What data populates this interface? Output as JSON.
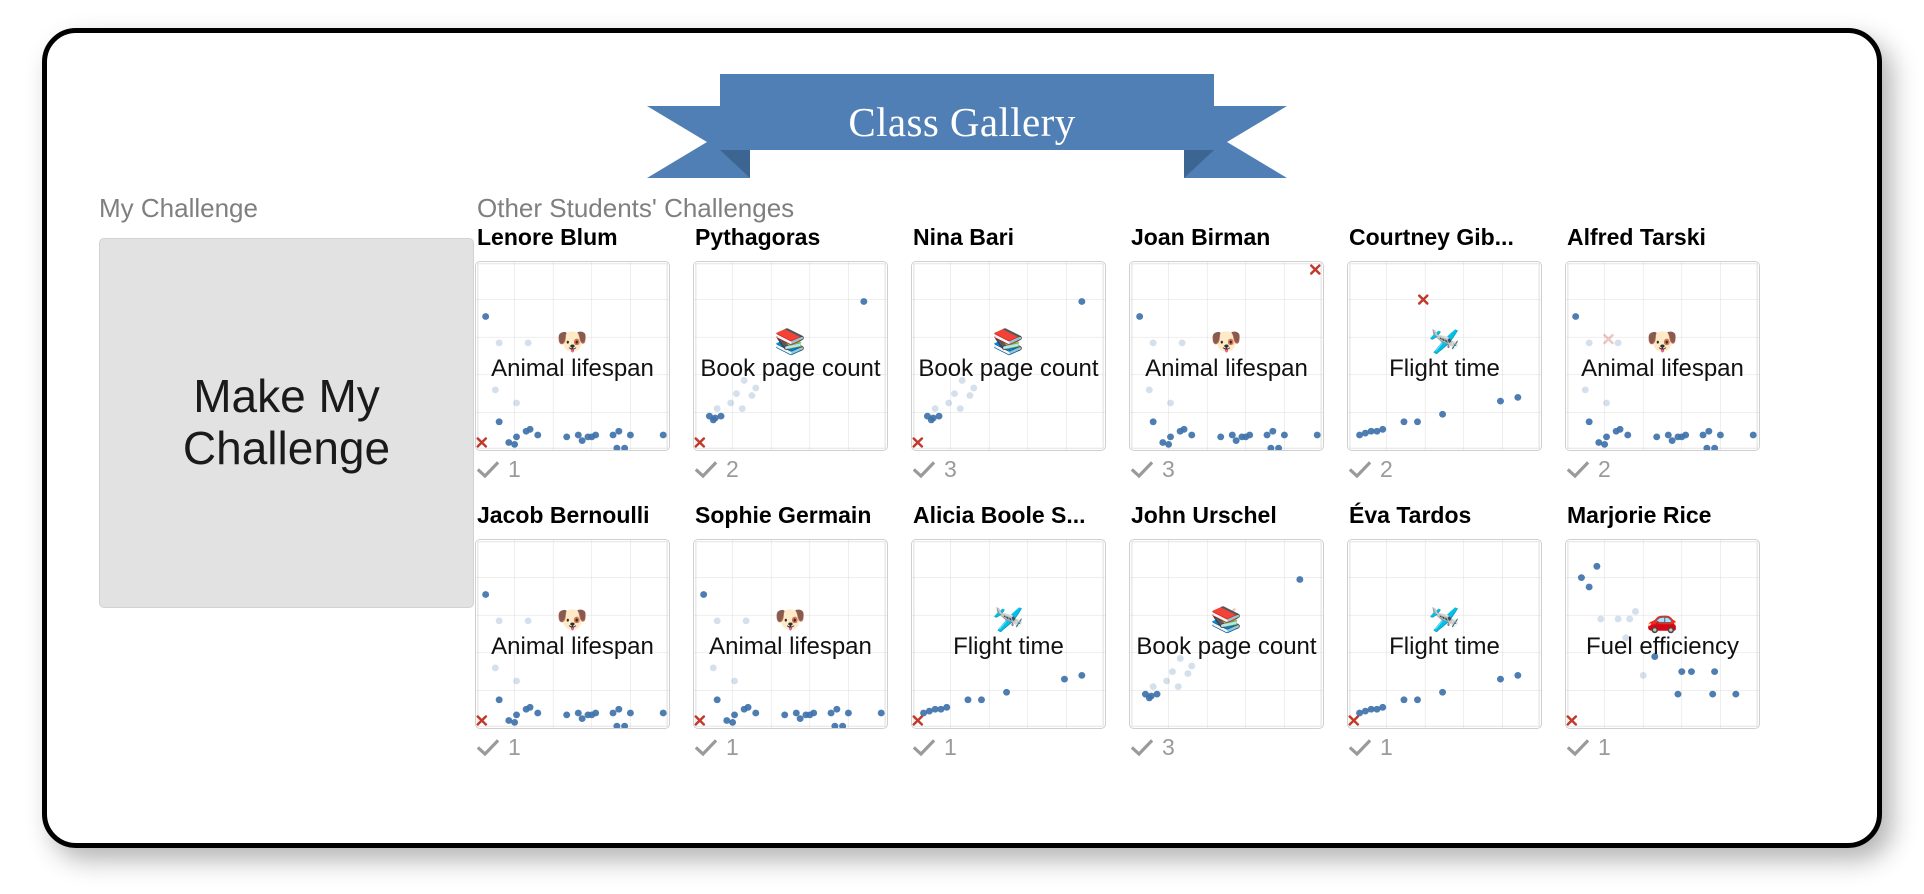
{
  "banner": {
    "title": "Class Gallery",
    "fill_color": "#4f7fb5",
    "fold_color": "#3d6592"
  },
  "my_challenge": {
    "label": "My Challenge",
    "button_label": "Make My Challenge"
  },
  "gallery": {
    "label": "Other Students' Challenges",
    "check_icon": "check-icon",
    "rows": [
      [
        {
          "name": "Lenore Blum",
          "emoji": "🐶",
          "emoji_name": "dog-face-emoji",
          "caption": "Animal lifespan",
          "votes": "1",
          "marker": {
            "x": 3,
            "y": 96,
            "opacity": 1
          },
          "points": [
            [
              5,
              29
            ],
            [
              12,
              43
            ],
            [
              27,
              43
            ],
            [
              10,
              68
            ],
            [
              21,
              75
            ],
            [
              12,
              85
            ],
            [
              21,
              93
            ],
            [
              26,
              90
            ],
            [
              28,
              89
            ],
            [
              32,
              92
            ],
            [
              17,
              96
            ],
            [
              20,
              97
            ],
            [
              47,
              93
            ],
            [
              53,
              92
            ],
            [
              55,
              95
            ],
            [
              58,
              93
            ],
            [
              60,
              93
            ],
            [
              62,
              92
            ],
            [
              71,
              92
            ],
            [
              74,
              90
            ],
            [
              80,
              92
            ],
            [
              73,
              101
            ],
            [
              77,
              103
            ],
            [
              97,
              92
            ]
          ]
        },
        {
          "name": "Pythagoras",
          "emoji": "📚",
          "emoji_name": "books-emoji",
          "caption": "Book page count",
          "votes": "2",
          "marker": {
            "x": 3,
            "y": 96,
            "opacity": 1
          },
          "points": [
            [
              88,
              21
            ],
            [
              26,
              63
            ],
            [
              32,
              67
            ],
            [
              22,
              70
            ],
            [
              30,
              71
            ],
            [
              19,
              75
            ],
            [
              12,
              78
            ],
            [
              25,
              78
            ],
            [
              8,
              82
            ],
            [
              11,
              83
            ],
            [
              14,
              82
            ],
            [
              10,
              84
            ]
          ]
        },
        {
          "name": "Nina Bari",
          "emoji": "📚",
          "emoji_name": "books-emoji",
          "caption": "Book page count",
          "votes": "3",
          "marker": {
            "x": 3,
            "y": 96,
            "opacity": 1
          },
          "points": [
            [
              88,
              21
            ],
            [
              26,
              63
            ],
            [
              32,
              67
            ],
            [
              22,
              70
            ],
            [
              30,
              71
            ],
            [
              19,
              75
            ],
            [
              12,
              78
            ],
            [
              25,
              78
            ],
            [
              8,
              82
            ],
            [
              11,
              83
            ],
            [
              14,
              82
            ],
            [
              10,
              84
            ]
          ]
        },
        {
          "name": "Joan Birman",
          "emoji": "🐶",
          "emoji_name": "dog-face-emoji",
          "caption": "Animal lifespan",
          "votes": "3",
          "marker": {
            "x": 96,
            "y": 4,
            "opacity": 1
          },
          "points": [
            [
              5,
              29
            ],
            [
              12,
              43
            ],
            [
              27,
              43
            ],
            [
              10,
              68
            ],
            [
              21,
              75
            ],
            [
              12,
              85
            ],
            [
              21,
              93
            ],
            [
              26,
              90
            ],
            [
              28,
              89
            ],
            [
              32,
              92
            ],
            [
              17,
              96
            ],
            [
              20,
              97
            ],
            [
              47,
              93
            ],
            [
              53,
              92
            ],
            [
              55,
              95
            ],
            [
              58,
              93
            ],
            [
              60,
              93
            ],
            [
              62,
              92
            ],
            [
              71,
              92
            ],
            [
              74,
              90
            ],
            [
              80,
              92
            ],
            [
              73,
              101
            ],
            [
              77,
              103
            ],
            [
              97,
              92
            ]
          ]
        },
        {
          "name": "Courtney Gib...",
          "emoji": "🛩️",
          "emoji_name": "airplane-emoji",
          "caption": "Flight time",
          "votes": "2",
          "marker": {
            "x": 39,
            "y": 20,
            "opacity": 1
          },
          "points": [
            [
              6,
              92
            ],
            [
              9,
              91
            ],
            [
              12,
              90
            ],
            [
              15,
              90
            ],
            [
              18,
              89
            ],
            [
              29,
              85
            ],
            [
              36,
              85
            ],
            [
              49,
              81
            ],
            [
              79,
              74
            ],
            [
              88,
              72
            ]
          ]
        },
        {
          "name": "Alfred Tarski",
          "emoji": "🐶",
          "emoji_name": "dog-face-emoji",
          "caption": "Animal lifespan",
          "votes": "2",
          "marker": {
            "x": 22,
            "y": 41,
            "opacity": 0.28
          },
          "points": [
            [
              5,
              29
            ],
            [
              12,
              43
            ],
            [
              27,
              43
            ],
            [
              10,
              68
            ],
            [
              21,
              75
            ],
            [
              12,
              85
            ],
            [
              21,
              93
            ],
            [
              26,
              90
            ],
            [
              28,
              89
            ],
            [
              32,
              92
            ],
            [
              17,
              96
            ],
            [
              20,
              97
            ],
            [
              47,
              93
            ],
            [
              53,
              92
            ],
            [
              55,
              95
            ],
            [
              58,
              93
            ],
            [
              60,
              93
            ],
            [
              62,
              92
            ],
            [
              71,
              92
            ],
            [
              74,
              90
            ],
            [
              80,
              92
            ],
            [
              73,
              101
            ],
            [
              77,
              103
            ],
            [
              97,
              92
            ]
          ]
        }
      ],
      [
        {
          "name": "Jacob Bernoulli",
          "emoji": "🐶",
          "emoji_name": "dog-face-emoji",
          "caption": "Animal lifespan",
          "votes": "1",
          "marker": {
            "x": 3,
            "y": 96,
            "opacity": 1
          },
          "points": [
            [
              5,
              29
            ],
            [
              12,
              43
            ],
            [
              27,
              43
            ],
            [
              10,
              68
            ],
            [
              21,
              75
            ],
            [
              12,
              85
            ],
            [
              21,
              93
            ],
            [
              26,
              90
            ],
            [
              28,
              89
            ],
            [
              32,
              92
            ],
            [
              17,
              96
            ],
            [
              20,
              97
            ],
            [
              47,
              93
            ],
            [
              53,
              92
            ],
            [
              55,
              95
            ],
            [
              58,
              93
            ],
            [
              60,
              93
            ],
            [
              62,
              92
            ],
            [
              71,
              92
            ],
            [
              74,
              90
            ],
            [
              80,
              92
            ],
            [
              73,
              101
            ],
            [
              77,
              103
            ],
            [
              97,
              92
            ]
          ]
        },
        {
          "name": "Sophie Germain",
          "emoji": "🐶",
          "emoji_name": "dog-face-emoji",
          "caption": "Animal lifespan",
          "votes": "1",
          "marker": {
            "x": 3,
            "y": 96,
            "opacity": 1
          },
          "points": [
            [
              5,
              29
            ],
            [
              12,
              43
            ],
            [
              27,
              43
            ],
            [
              10,
              68
            ],
            [
              21,
              75
            ],
            [
              12,
              85
            ],
            [
              21,
              93
            ],
            [
              26,
              90
            ],
            [
              28,
              89
            ],
            [
              32,
              92
            ],
            [
              17,
              96
            ],
            [
              20,
              97
            ],
            [
              47,
              93
            ],
            [
              53,
              92
            ],
            [
              55,
              95
            ],
            [
              58,
              93
            ],
            [
              60,
              93
            ],
            [
              62,
              92
            ],
            [
              71,
              92
            ],
            [
              74,
              90
            ],
            [
              80,
              92
            ],
            [
              73,
              101
            ],
            [
              77,
              103
            ],
            [
              97,
              92
            ]
          ]
        },
        {
          "name": "Alicia Boole S...",
          "emoji": "🛩️",
          "emoji_name": "airplane-emoji",
          "caption": "Flight time",
          "votes": "1",
          "marker": {
            "x": 3,
            "y": 96,
            "opacity": 1
          },
          "points": [
            [
              6,
              92
            ],
            [
              9,
              91
            ],
            [
              12,
              90
            ],
            [
              15,
              90
            ],
            [
              18,
              89
            ],
            [
              29,
              85
            ],
            [
              36,
              85
            ],
            [
              49,
              81
            ],
            [
              79,
              74
            ],
            [
              88,
              72
            ]
          ]
        },
        {
          "name": "John Urschel",
          "emoji": "📚",
          "emoji_name": "books-emoji",
          "caption": "Book page count",
          "votes": "3",
          "marker": {
            "x": 52,
            "y": 39,
            "opacity": 0.28
          },
          "points": [
            [
              88,
              21
            ],
            [
              26,
              63
            ],
            [
              32,
              67
            ],
            [
              22,
              70
            ],
            [
              30,
              71
            ],
            [
              19,
              75
            ],
            [
              12,
              78
            ],
            [
              25,
              78
            ],
            [
              8,
              82
            ],
            [
              11,
              83
            ],
            [
              14,
              82
            ],
            [
              10,
              84
            ]
          ]
        },
        {
          "name": "Éva Tardos",
          "emoji": "🛩️",
          "emoji_name": "airplane-emoji",
          "caption": "Flight time",
          "votes": "1",
          "marker": {
            "x": 3,
            "y": 96,
            "opacity": 1
          },
          "points": [
            [
              6,
              92
            ],
            [
              9,
              91
            ],
            [
              12,
              90
            ],
            [
              15,
              90
            ],
            [
              18,
              89
            ],
            [
              29,
              85
            ],
            [
              36,
              85
            ],
            [
              49,
              81
            ],
            [
              79,
              74
            ],
            [
              88,
              72
            ]
          ]
        },
        {
          "name": "Marjorie Rice",
          "emoji": "🚗",
          "emoji_name": "car-emoji",
          "caption": "Fuel efficiency",
          "votes": "1",
          "marker": {
            "x": 3,
            "y": 96,
            "opacity": 1
          },
          "points": [
            [
              16,
              14
            ],
            [
              8,
              20
            ],
            [
              12,
              25
            ],
            [
              36,
              38
            ],
            [
              18,
              42
            ],
            [
              27,
              42
            ],
            [
              33,
              42
            ],
            [
              31,
              52
            ],
            [
              46,
              62
            ],
            [
              40,
              72
            ],
            [
              60,
              70
            ],
            [
              65,
              70
            ],
            [
              77,
              70
            ],
            [
              58,
              82
            ],
            [
              76,
              82
            ],
            [
              88,
              82
            ]
          ]
        }
      ]
    ]
  },
  "chart_data": {
    "type": "scatter",
    "grid": true,
    "grid_divisions": 5,
    "xlim": [
      0,
      100
    ],
    "ylim": [
      0,
      100
    ],
    "xlabel": "",
    "ylabel": "",
    "point_color": "#3f72ab",
    "marker_color": "#c0392b",
    "note": "Each gallery card thumbnail is a miniature scatter plot on a 5x5 grid; coordinates are percentages of the plot box."
  }
}
